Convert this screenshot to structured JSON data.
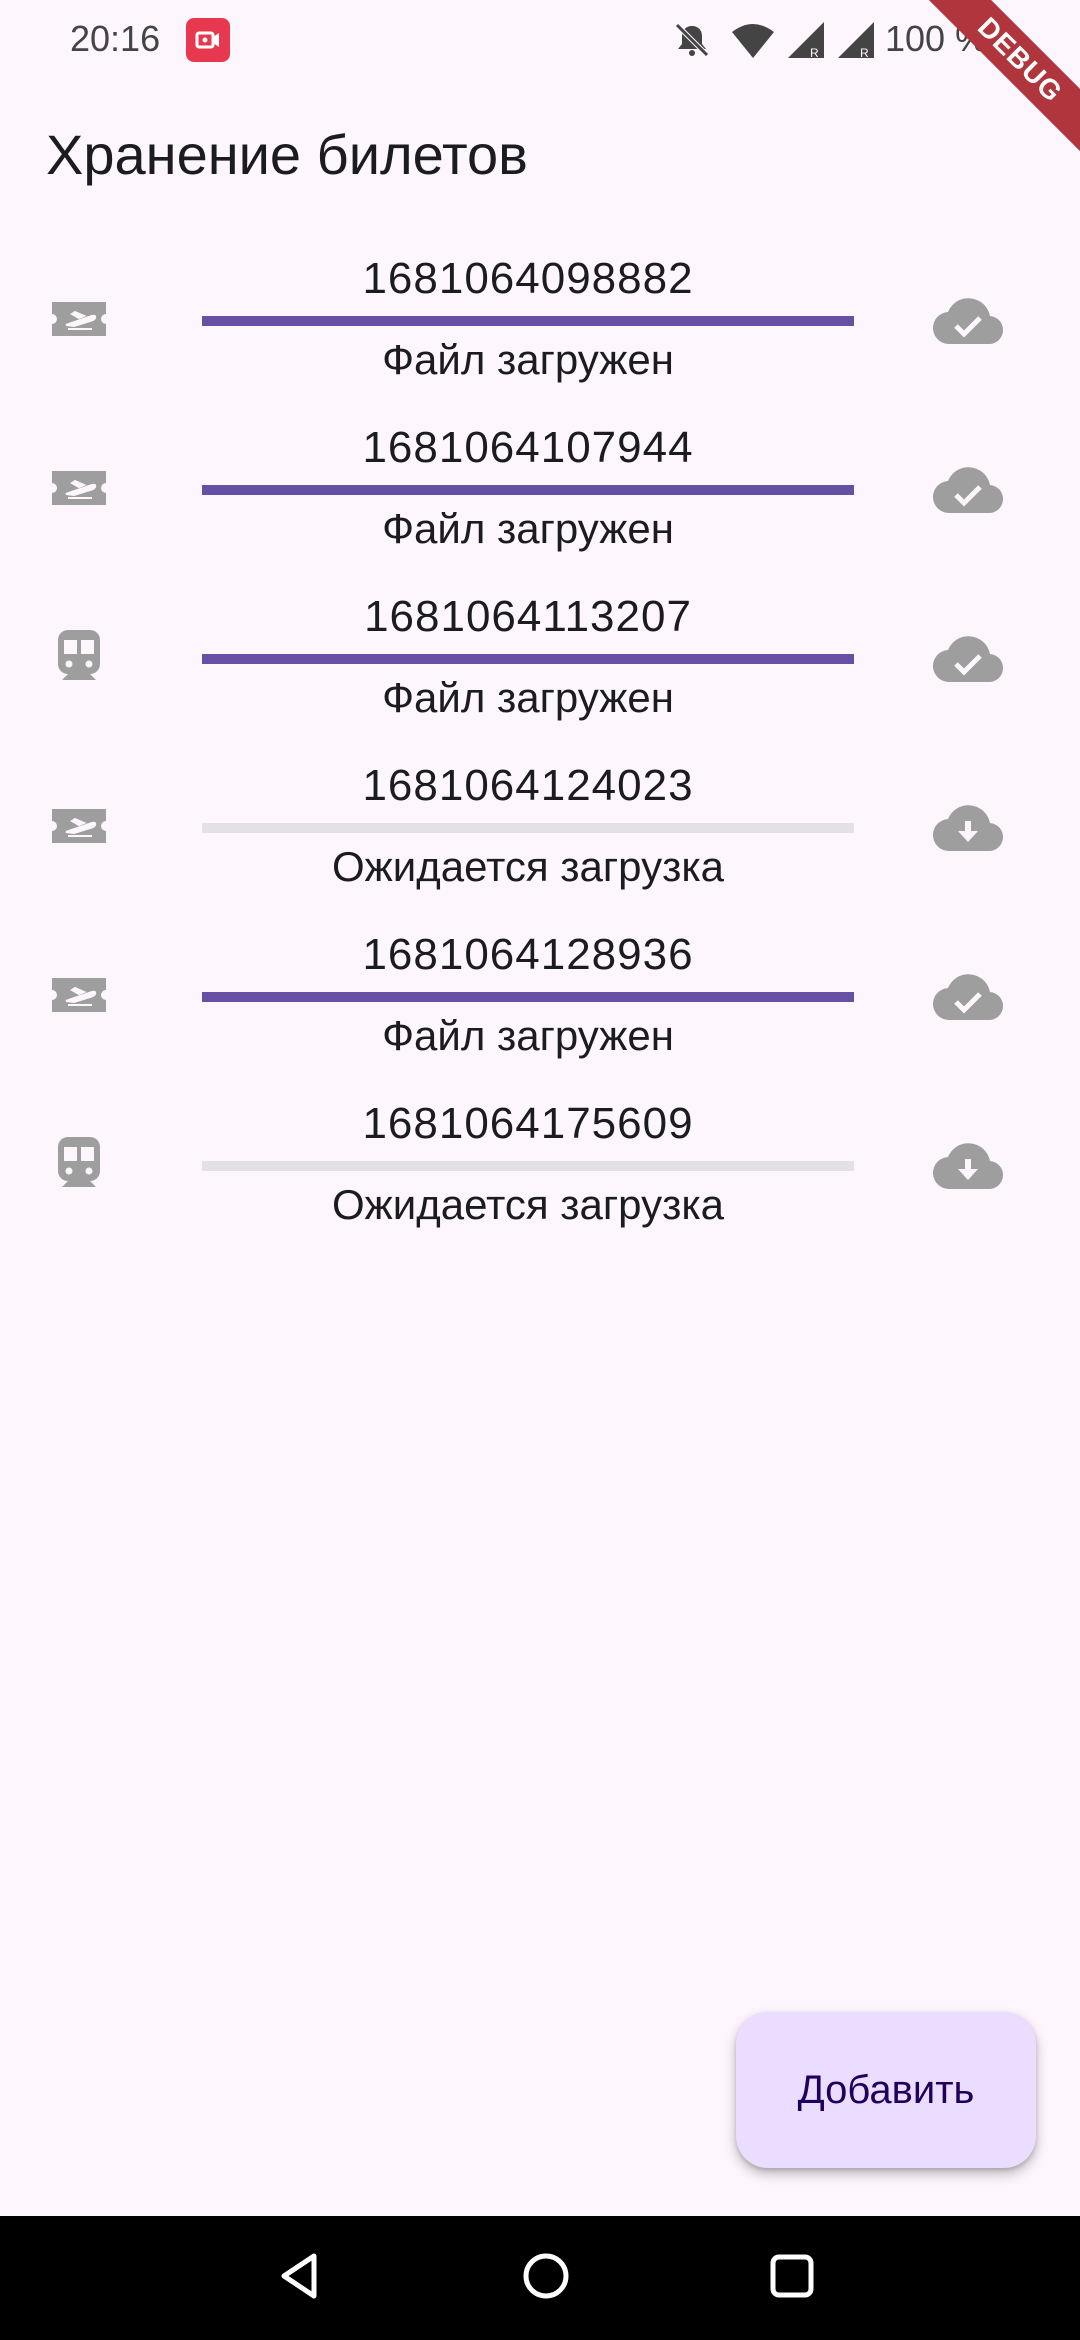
{
  "status_bar": {
    "time": "20:16",
    "battery": "100 %",
    "icons": [
      "screen-record-icon",
      "bell-off-icon",
      "wifi-icon",
      "signal-icon",
      "signal-icon",
      "battery-icon"
    ]
  },
  "debug_label": "DEBUG",
  "app": {
    "title": "Хранение билетов"
  },
  "tickets": [
    {
      "type": "plane",
      "number": "1681064098882",
      "status": "Файл загружен",
      "progress": 1.0,
      "cloud": "cloud-done"
    },
    {
      "type": "plane",
      "number": "1681064107944",
      "status": "Файл загружен",
      "progress": 1.0,
      "cloud": "cloud-done"
    },
    {
      "type": "train",
      "number": "1681064113207",
      "status": "Файл загружен",
      "progress": 1.0,
      "cloud": "cloud-done"
    },
    {
      "type": "plane",
      "number": "1681064124023",
      "status": "Ожидается загрузка",
      "progress": 0.0,
      "cloud": "cloud-download"
    },
    {
      "type": "plane",
      "number": "1681064128936",
      "status": "Файл загружен",
      "progress": 1.0,
      "cloud": "cloud-done"
    },
    {
      "type": "train",
      "number": "1681064175609",
      "status": "Ожидается загрузка",
      "progress": 0.0,
      "cloud": "cloud-download"
    }
  ],
  "fab": {
    "label": "Добавить"
  },
  "colors": {
    "accent": "#6750a4",
    "track": "#e4e0e8",
    "icon_grey": "#9e9e9e",
    "fab_bg": "#eaddff",
    "background": "#fdf7fd"
  }
}
